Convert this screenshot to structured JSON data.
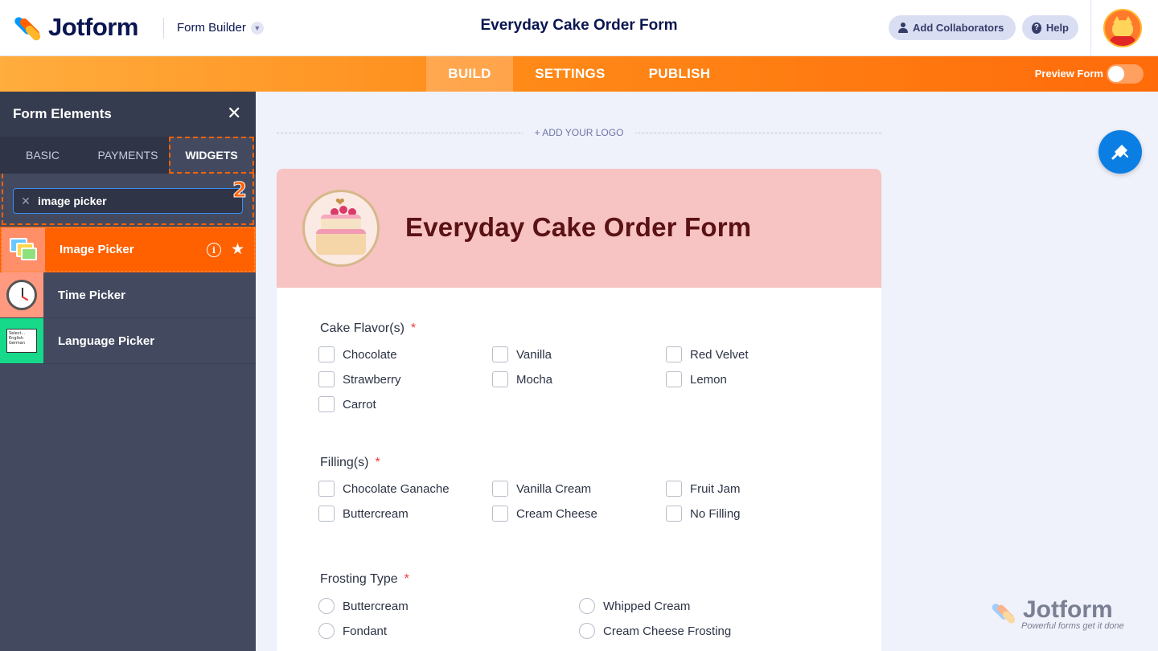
{
  "header": {
    "brand": "Jotform",
    "builder_label": "Form Builder",
    "title": "Everyday Cake Order Form",
    "add_collaborators": "Add Collaborators",
    "help": "Help"
  },
  "nav": {
    "tabs": [
      "BUILD",
      "SETTINGS",
      "PUBLISH"
    ],
    "active": "BUILD",
    "preview_label": "Preview Form",
    "preview_on": false
  },
  "sidebar": {
    "title": "Form Elements",
    "tabs": [
      "BASIC",
      "PAYMENTS",
      "WIDGETS"
    ],
    "active_tab": "WIDGETS",
    "search_value": "image picker",
    "step_marker": "2",
    "items": [
      {
        "label": "Image Picker",
        "icon": "image-gallery-icon",
        "active": true
      },
      {
        "label": "Time Picker",
        "icon": "clock-icon",
        "active": false
      },
      {
        "label": "Language Picker",
        "icon": "language-select-icon",
        "active": false
      }
    ],
    "lang_thumb_lines": [
      "Select...",
      "English",
      "German"
    ]
  },
  "canvas": {
    "add_logo": "+ ADD YOUR LOGO",
    "form_title": "Everyday Cake Order Form",
    "questions": [
      {
        "label": "Cake Flavor(s)",
        "required": "*",
        "type": "checkbox",
        "options": [
          "Chocolate",
          "Vanilla",
          "Red Velvet",
          "Strawberry",
          "Mocha",
          "Lemon",
          "Carrot"
        ]
      },
      {
        "label": "Filling(s)",
        "required": "*",
        "type": "checkbox",
        "options": [
          "Chocolate Ganache",
          "Vanilla Cream",
          "Fruit Jam",
          "Buttercream",
          "Cream Cheese",
          "No Filling"
        ]
      },
      {
        "label": "Frosting Type",
        "required": "*",
        "type": "radio",
        "options": [
          "Buttercream",
          "Whipped Cream",
          "Fondant",
          "Cream Cheese Frosting"
        ]
      }
    ]
  },
  "watermark": {
    "brand": "Jotform",
    "tagline": "Powerful forms get it done"
  },
  "colors": {
    "orange": "#ff6100",
    "navy": "#0a1551",
    "sidebar": "#434a60",
    "header_pink": "#f7c3c3",
    "title_maroon": "#5b1215",
    "blue": "#0b7ee3"
  }
}
